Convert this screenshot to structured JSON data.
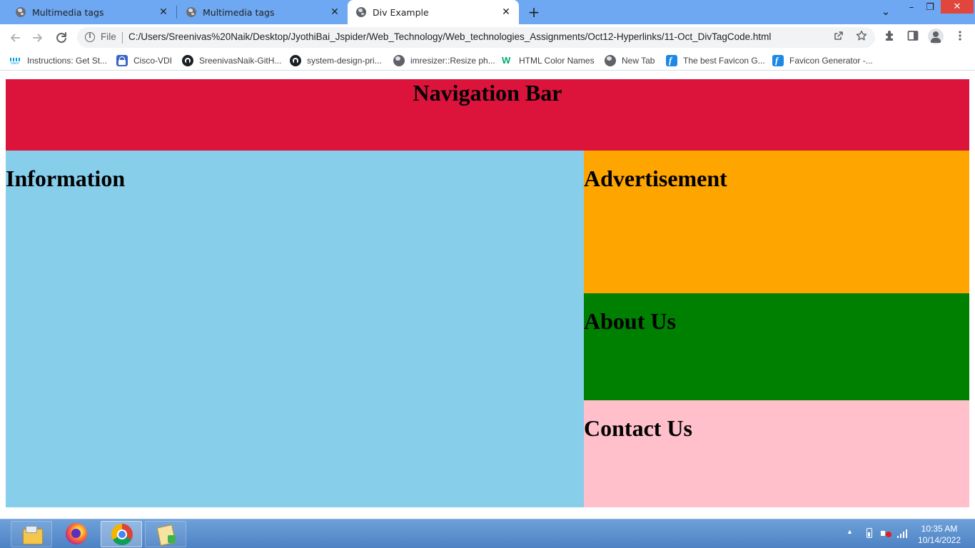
{
  "browser": {
    "tabs": [
      {
        "title": "Multimedia tags",
        "active": false
      },
      {
        "title": "Multimedia tags",
        "active": false
      },
      {
        "title": "Div Example",
        "active": true
      }
    ],
    "new_tab_symbol": "+",
    "tab_close_symbol": "✕",
    "window_controls": {
      "menu": "⌄",
      "minimize": "–",
      "restore": "❐",
      "close": "✕"
    },
    "nav": {
      "back_icon": "arrow-left-icon",
      "forward_icon": "arrow-right-icon",
      "reload_icon": "reload-icon"
    },
    "address_bar": {
      "scheme_label": "File",
      "url": "C:/Users/Sreenivas%20Naik/Desktop/JyothiBai_Jspider/Web_Technology/Web_technologies_Assignments/Oct12-Hyperlinks/11-Oct_DivTagCode.html"
    },
    "bookmarks": [
      {
        "label": "Instructions: Get St...",
        "icon": "cisco-icon"
      },
      {
        "label": "Cisco-VDI",
        "icon": "lock-icon"
      },
      {
        "label": "SreenivasNaik-GitH...",
        "icon": "github-icon"
      },
      {
        "label": "system-design-pri...",
        "icon": "github-icon"
      },
      {
        "label": "imresizer::Resize ph...",
        "icon": "globe-icon"
      },
      {
        "label": "HTML Color Names",
        "icon": "w3schools-icon"
      },
      {
        "label": "New Tab",
        "icon": "globe-icon"
      },
      {
        "label": "The best Favicon G...",
        "icon": "favicon-icon"
      },
      {
        "label": "Favicon Generator -...",
        "icon": "favicon-icon"
      }
    ]
  },
  "page": {
    "nav_bar": {
      "heading": "Navigation Bar",
      "color": "#dc143c"
    },
    "information": {
      "heading": "Information",
      "color": "#87ceeb"
    },
    "advertisement": {
      "heading": "Advertisement",
      "color": "#ffa500"
    },
    "about_us": {
      "heading": "About Us",
      "color": "#008000"
    },
    "contact_us": {
      "heading": "Contact Us",
      "color": "#ffc0cb"
    }
  },
  "taskbar": {
    "apps": [
      "file-explorer-icon",
      "firefox-icon",
      "chrome-icon",
      "notepad-plus-icon"
    ],
    "tray_arrow": "▲",
    "clock": {
      "time": "10:35 AM",
      "date": "10/14/2022"
    }
  }
}
